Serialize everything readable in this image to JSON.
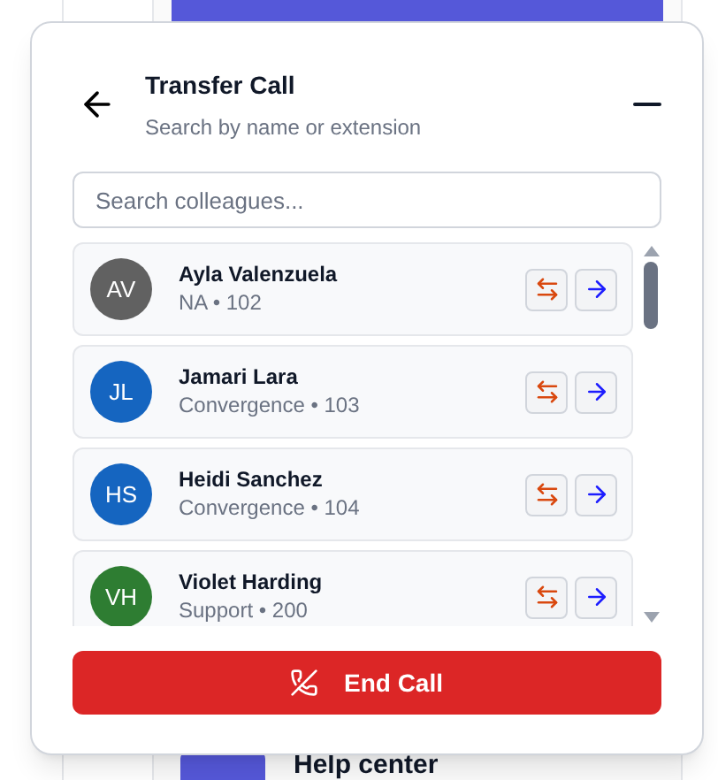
{
  "background": {
    "help_link": "Help center"
  },
  "dialog": {
    "title": "Transfer Call",
    "subtitle": "Search by name or extension",
    "search": {
      "placeholder": "Search colleagues..."
    },
    "colleagues": [
      {
        "initials": "AV",
        "name": "Ayla Valenzuela",
        "detail": "NA • 102",
        "color": "#616161"
      },
      {
        "initials": "JL",
        "name": "Jamari Lara",
        "detail": "Convergence • 103",
        "color": "#1565c0"
      },
      {
        "initials": "HS",
        "name": "Heidi Sanchez",
        "detail": "Convergence • 104",
        "color": "#1565c0"
      },
      {
        "initials": "VH",
        "name": "Violet Harding",
        "detail": "Support • 200",
        "color": "#2e7d32"
      }
    ],
    "end_button": "End Call"
  }
}
